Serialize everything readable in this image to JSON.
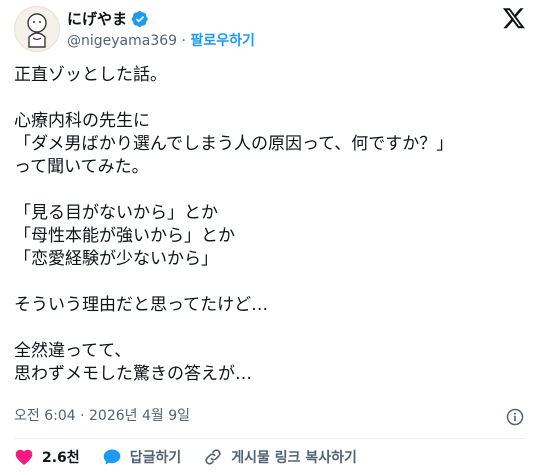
{
  "author": {
    "display_name": "にげやま",
    "handle": "@nigeyama369",
    "separator": "·",
    "follow_label": "팔로우하기"
  },
  "post": {
    "text": "正直ゾッとした話。\n\n心療内科の先生に\n「ダメ男ばかり選んでしまう人の原因って、何ですか？」\nって聞いてみた。\n\n「見る目がないから」とか\n「母性本能が強いから」とか\n「恋愛経験が少ないから」\n\nそういう理由だと思ってたけど…\n\n全然違ってて、\n思わずメモした驚きの答えが…",
    "timestamp": "오전 6:04 · 2026년 4월 9일"
  },
  "actions": {
    "like_count": "2.6천",
    "reply_label": "답글하기",
    "copy_link_label": "게시물 링크 복사하기"
  },
  "colors": {
    "accent": "#1d9bf0",
    "like": "#f91880",
    "text": "#0f1419",
    "secondary": "#536471"
  },
  "icons": {
    "verified": "verified-badge-icon",
    "brand": "x-logo-icon",
    "info": "info-icon",
    "like": "heart-icon",
    "reply": "reply-bubble-icon",
    "link": "link-icon"
  }
}
